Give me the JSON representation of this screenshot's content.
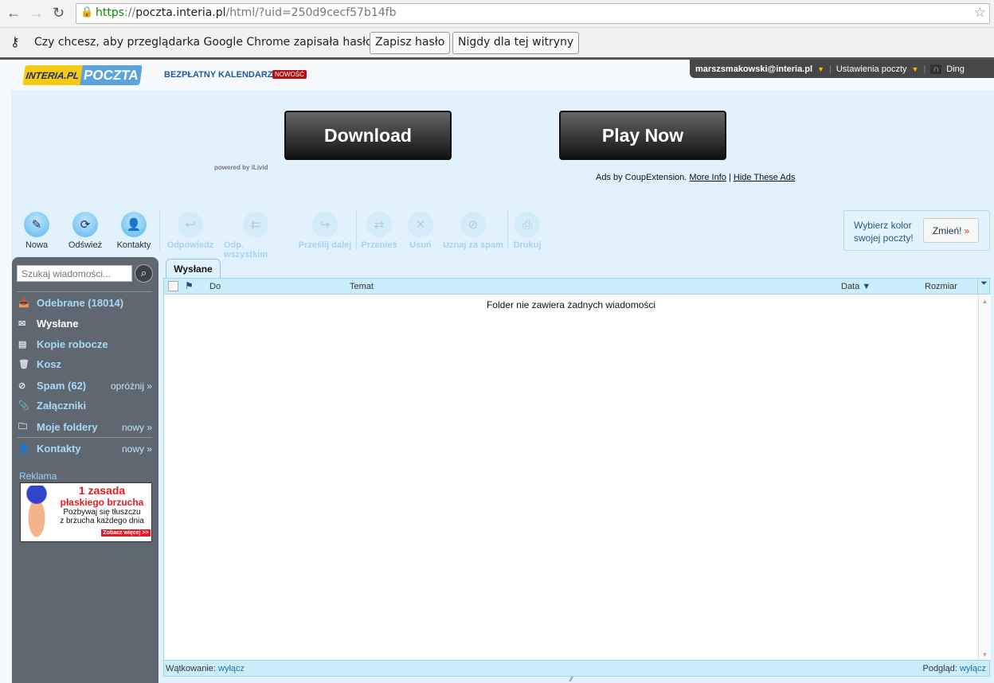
{
  "browser": {
    "url_scheme": "https",
    "url_sep": "://",
    "url_domain": "poczta.interia.pl",
    "url_path": "/html/?uid=250d9cecf57b14fb",
    "infobar_text": "Czy chcesz, aby przeglądarka Google Chrome zapisała hasło?",
    "save_label": "Zapisz hasło",
    "never_label": "Nigdy dla tej witryny"
  },
  "header": {
    "logo_left": "INTERIA.PL",
    "logo_right": "POCZTA",
    "calendar": "BEZPŁATNY KALENDARZ",
    "new_badge": "NOWOŚĆ",
    "account": "marszsmakowski@interia.pl",
    "settings": "Ustawienia poczty",
    "ding": "Ding"
  },
  "ad": {
    "download": "Download",
    "play": "Play Now",
    "powered": "powered by iLivid",
    "ads_by": "Ads by CoupExtension.",
    "more_info": "More Info",
    "sep": "|",
    "hide": "Hide These Ads"
  },
  "toolbar": [
    {
      "label": "Nowa",
      "icon": "compose-icon",
      "enabled": true
    },
    {
      "label": "Odśwież",
      "icon": "refresh-icon",
      "enabled": true
    },
    {
      "label": "Kontakty",
      "icon": "contacts-icon",
      "enabled": true
    },
    {
      "label": "Odpowiedz",
      "icon": "reply-icon",
      "enabled": false
    },
    {
      "label": "Odp. wszystkim",
      "icon": "reply-all-icon",
      "enabled": false
    },
    {
      "label": "Prześlij dalej",
      "icon": "forward-icon",
      "enabled": false
    },
    {
      "label": "Przenieś",
      "icon": "move-icon",
      "enabled": false
    },
    {
      "label": "Usuń",
      "icon": "delete-icon",
      "enabled": false
    },
    {
      "label": "Uznaj za spam",
      "icon": "spam-icon",
      "enabled": false
    },
    {
      "label": "Drukuj",
      "icon": "print-icon",
      "enabled": false
    }
  ],
  "color_box": {
    "text1": "Wybierz kolor",
    "text2": "swojej poczty!",
    "button": "Zmień!",
    "arrow": "»"
  },
  "sidebar": {
    "search_placeholder": "Szukaj wiadomości...",
    "folders": [
      {
        "label": "Odebrane (18014)"
      },
      {
        "label": "Wysłane",
        "active": true
      },
      {
        "label": "Kopie robocze"
      },
      {
        "label": "Kosz"
      },
      {
        "label": "Spam  (62)",
        "action": "opróżnij »"
      },
      {
        "label": "Załączniki"
      },
      {
        "label": "Moje foldery",
        "action": "nowy »"
      },
      {
        "label": "Kontakty",
        "action": "nowy »"
      }
    ],
    "ad_label": "Reklama",
    "ad_line1": "1 zasada",
    "ad_line2": "płaskiego brzucha",
    "ad_line3": "Pozbywaj się tłuszczu",
    "ad_line4": "z brzucha każdego dnia",
    "ad_cta": "Zobacz więcej >>"
  },
  "mail": {
    "tab": "Wysłane",
    "columns": {
      "to": "Do",
      "subject": "Temat",
      "date": "Data",
      "size": "Rozmiar"
    },
    "empty": "Folder nie zawiera żadnych wiadomości",
    "threading_label": "Wątkowanie:",
    "threading_link": "wyłącz",
    "preview_label": "Podgląd:",
    "preview_link": "wyłącz"
  }
}
